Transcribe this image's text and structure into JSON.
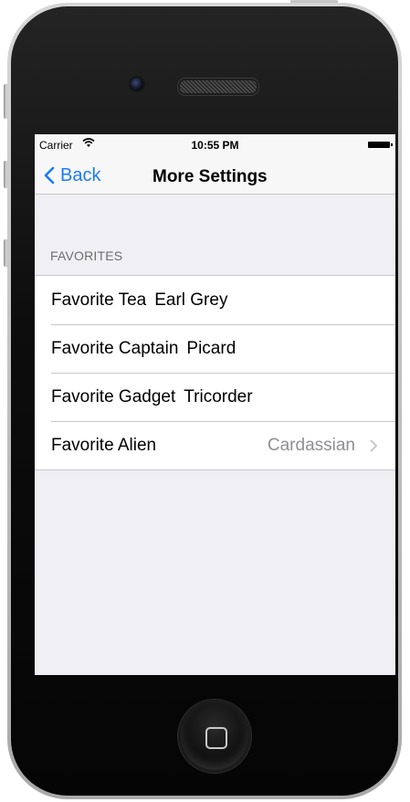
{
  "status_bar": {
    "carrier": "Carrier",
    "time": "10:55 PM"
  },
  "nav": {
    "back_label": "Back",
    "title": "More Settings"
  },
  "section": {
    "header": "FAVORITES",
    "rows": [
      {
        "label": "Favorite Tea",
        "value": "Earl Grey",
        "value_style": "inline",
        "has_chevron": false
      },
      {
        "label": "Favorite Captain",
        "value": "Picard",
        "value_style": "inline",
        "has_chevron": false
      },
      {
        "label": "Favorite Gadget",
        "value": "Tricorder",
        "value_style": "inline",
        "has_chevron": false
      },
      {
        "label": "Favorite Alien",
        "value": "Cardassian",
        "value_style": "right-detail",
        "has_chevron": true
      }
    ]
  },
  "icons": [
    "wifi-icon",
    "battery-icon",
    "back-chevron-icon",
    "disclosure-chevron-icon",
    "home-button-icon",
    "front-camera-icon",
    "speaker-grille-icon"
  ],
  "colors": {
    "tint": "#1a7cf5",
    "background": "#efeff4",
    "detail_text": "#8e8e93",
    "section_header": "#6d6d72",
    "separator": "#c8c7cc"
  }
}
